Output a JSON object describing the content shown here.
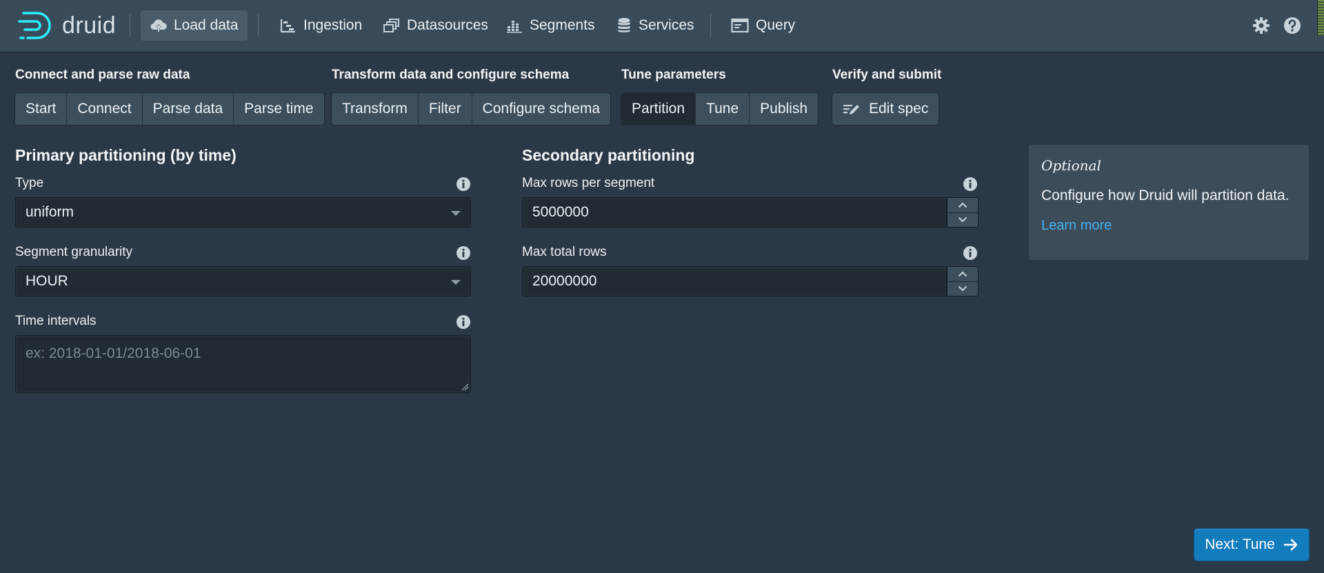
{
  "app": {
    "logo_text": "druid"
  },
  "nav": {
    "items": [
      {
        "label": "Load data",
        "icon": "cloud-upload-icon",
        "active": true
      },
      {
        "label": "Ingestion",
        "icon": "gantt-chart-icon"
      },
      {
        "label": "Datasources",
        "icon": "multi-select-icon"
      },
      {
        "label": "Segments",
        "icon": "stacked-chart-icon"
      },
      {
        "label": "Services",
        "icon": "database-icon"
      },
      {
        "label": "Query",
        "icon": "application-icon"
      }
    ],
    "right_icons": [
      "gear-icon",
      "help-icon"
    ]
  },
  "steps": {
    "groups": [
      {
        "title": "Connect and parse raw data",
        "buttons": [
          "Start",
          "Connect",
          "Parse data",
          "Parse time"
        ]
      },
      {
        "title": "Transform data and configure schema",
        "buttons": [
          "Transform",
          "Filter",
          "Configure schema"
        ]
      },
      {
        "title": "Tune parameters",
        "buttons": [
          "Partition",
          "Tune",
          "Publish"
        ],
        "active": "Partition"
      },
      {
        "title": "Verify and submit",
        "buttons": [
          "Edit spec"
        ]
      }
    ]
  },
  "primary": {
    "title": "Primary partitioning (by time)",
    "type_label": "Type",
    "type_value": "uniform",
    "granularity_label": "Segment granularity",
    "granularity_value": "HOUR",
    "intervals_label": "Time intervals",
    "intervals_placeholder": "ex: 2018-01-01/2018-06-01"
  },
  "secondary": {
    "title": "Secondary partitioning",
    "max_rows_label": "Max rows per segment",
    "max_rows_value": "5000000",
    "max_total_label": "Max total rows",
    "max_total_value": "20000000"
  },
  "callout": {
    "title": "Optional",
    "text": "Configure how Druid will partition data.",
    "link": "Learn more"
  },
  "next_button": {
    "label": "Next: Tune"
  },
  "colors": {
    "background": "#2b3845",
    "navbar": "#394b59",
    "primary": "#137cbd",
    "link": "#48aff0"
  }
}
